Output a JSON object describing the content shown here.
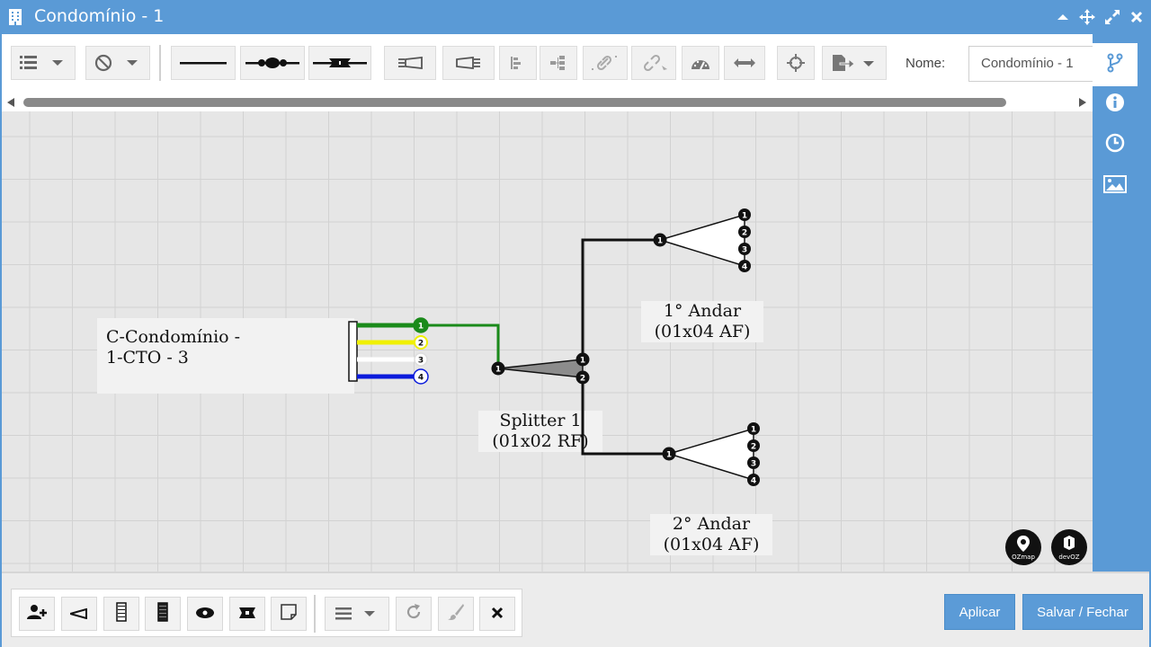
{
  "window": {
    "title": "Condomínio - 1"
  },
  "toolbar": {
    "nome_label": "Nome:",
    "nome_value": "Condomínio - 1",
    "buttons": [
      "list-dropdown",
      "block-dropdown",
      "line-tool",
      "fusion-tool",
      "connector-tool",
      "splitter-in-tool",
      "splitter-out-tool",
      "align-tool",
      "tree-tool",
      "link-tool",
      "unlink-tool",
      "gauge-tool",
      "measure-tool",
      "center-tool",
      "export-dropdown"
    ]
  },
  "sidepanel": {
    "items": [
      "branch-icon",
      "info-icon",
      "clock-icon",
      "image-icon"
    ]
  },
  "diagram": {
    "cto_label_line1": "C-Condomínio -",
    "cto_label_line2": "1-CTO - 3",
    "cto_fibers": [
      {
        "num": "1",
        "color": "#1a8a1a"
      },
      {
        "num": "2",
        "color": "#f0f000"
      },
      {
        "num": "3",
        "color": "#ffffff"
      },
      {
        "num": "4",
        "color": "#0a1adb"
      }
    ],
    "splitter_main": {
      "line1": "Splitter 1",
      "line2": "(01x02 RF)",
      "ports_in": [
        "1"
      ],
      "ports_out": [
        "1",
        "2"
      ]
    },
    "splitter_andar1": {
      "line1": "1° Andar",
      "line2": "(01x04 AF)",
      "ports_in": [
        "1"
      ],
      "ports_out": [
        "1",
        "2",
        "3",
        "4"
      ]
    },
    "splitter_andar2": {
      "line1": "2° Andar",
      "line2": "(01x04 AF)",
      "ports_in": [
        "1"
      ],
      "ports_out": [
        "1",
        "2",
        "3",
        "4"
      ]
    },
    "logos": [
      "OZmap",
      "devOZ"
    ]
  },
  "bottombar": {
    "tools": [
      "add-user-icon",
      "splitter-small-icon",
      "cable-icon",
      "cable-dark-icon",
      "eye-icon",
      "tag-icon",
      "note-icon",
      "align-dropdown",
      "refresh-icon",
      "brush-icon",
      "close-icon"
    ],
    "apply_label": "Aplicar",
    "save_close_label": "Salvar / Fechar"
  },
  "colors": {
    "accent": "#5a9ad6",
    "fiber_green": "#1a8a1a",
    "fiber_yellow": "#f0f000",
    "fiber_blue": "#0a1adb"
  }
}
